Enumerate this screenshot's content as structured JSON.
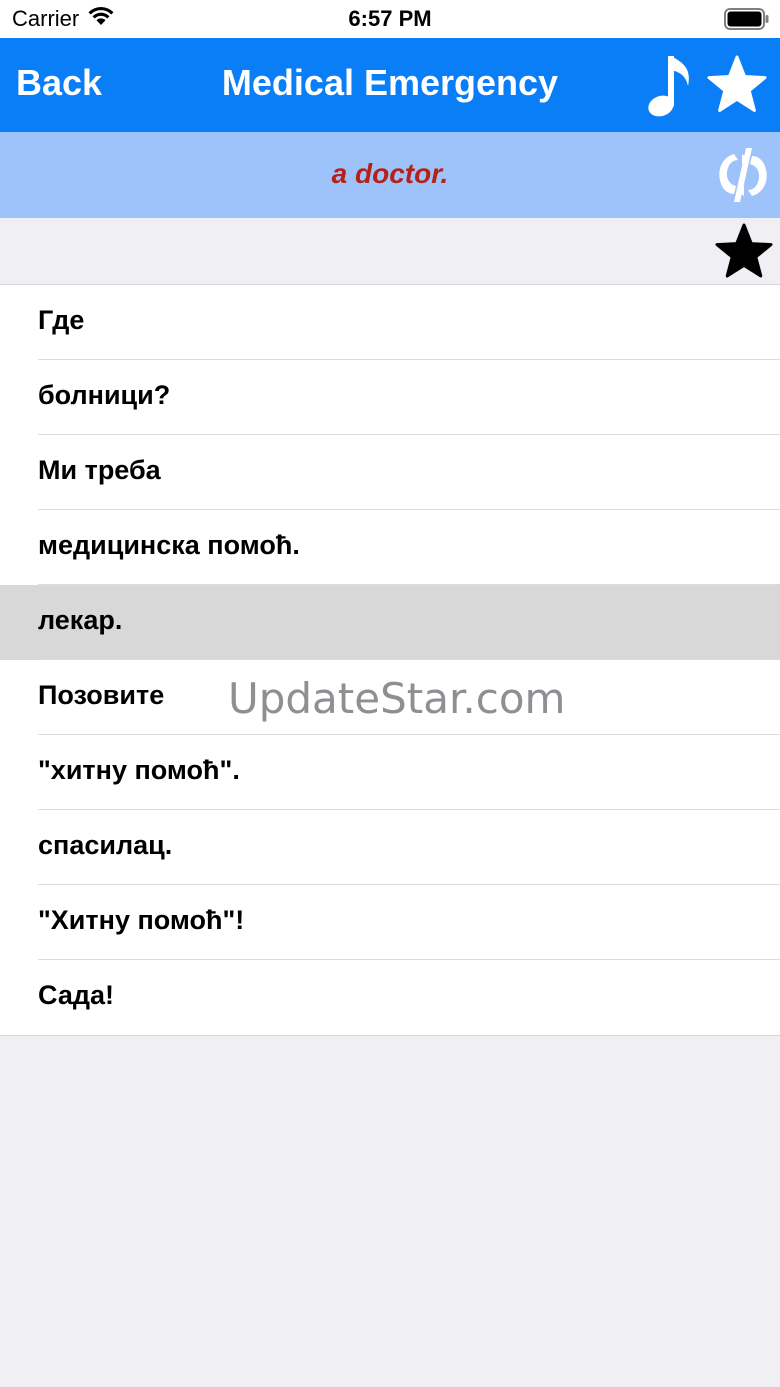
{
  "status_bar": {
    "carrier": "Carrier",
    "time": "6:57 PM"
  },
  "nav": {
    "back_label": "Back",
    "title": "Medical Emergency",
    "color": "#0a7ef6"
  },
  "banner": {
    "translation": "a doctor.",
    "text_color": "#b3231a",
    "background": "#9ec3fb"
  },
  "icons": {
    "music": "music-note-icon",
    "favorite": "star-icon",
    "flip": "flip-language-icon",
    "row_favorite": "star-icon"
  },
  "phrases": [
    {
      "text": "Где",
      "selected": false
    },
    {
      "text": "болници?",
      "selected": false
    },
    {
      "text": "Ми треба",
      "selected": false
    },
    {
      "text": "медицинска помоћ.",
      "selected": false
    },
    {
      "text": "лекар.",
      "selected": true
    },
    {
      "text": "Позовите",
      "selected": false
    },
    {
      "text": "\"хитну помоћ\".",
      "selected": false
    },
    {
      "text": "спасилац.",
      "selected": false
    },
    {
      "text": "\"Хитну помоћ\"!",
      "selected": false
    },
    {
      "text": "Сада!",
      "selected": false
    }
  ],
  "watermark": "UpdateStar.com"
}
